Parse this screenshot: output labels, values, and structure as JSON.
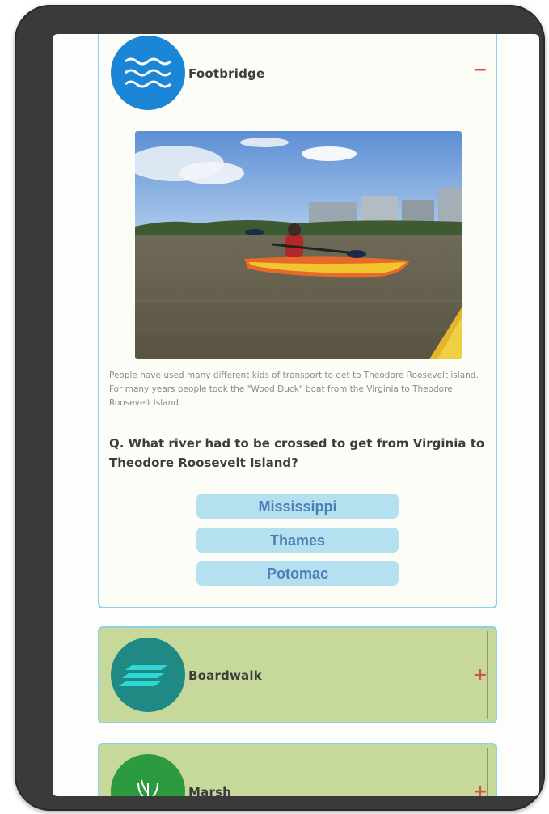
{
  "sections": [
    {
      "title": "Footbridge",
      "toggle": "−",
      "caption": "People have used many different kids of transport to get to Theodore Roosevelt island. For many years people took the \"Wood Duck\" boat from the Virginia to Theodore Roosevelt Island.",
      "question": "Q. What river had to be crossed to get from Virginia to Theodore Roosevelt Island?",
      "answers": [
        "Mississippi",
        "Thames",
        "Potomac"
      ],
      "badge_color": "#1b86d6",
      "icon": "waves-icon"
    },
    {
      "title": "Boardwalk",
      "toggle": "+",
      "badge_color": "#1f8a84",
      "icon": "boardwalk-icon"
    },
    {
      "title": "Marsh",
      "toggle": "+",
      "badge_color": "#2c9a3e",
      "icon": "reeds-icon"
    }
  ],
  "colors": {
    "card_border": "#88d3ec",
    "closed_card_bg": "#c6d89a",
    "answer_bg": "#b5e0ef",
    "answer_text": "#4c7fb8",
    "toggle": "#d55050"
  }
}
